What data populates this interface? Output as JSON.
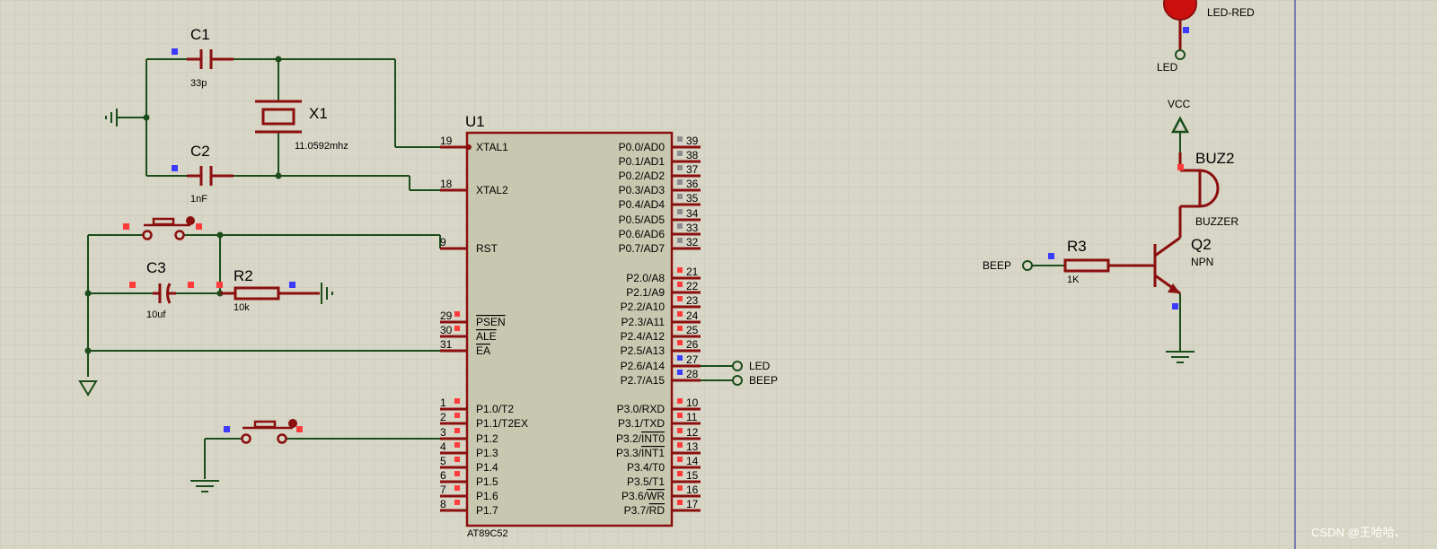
{
  "chip": {
    "ref": "U1",
    "part": "AT89C52",
    "left_pins": [
      {
        "num": "19",
        "name": "XTAL1"
      },
      {
        "num": "18",
        "name": "XTAL2"
      },
      {
        "num": "9",
        "name": "RST"
      },
      {
        "num": "29",
        "name": "PSEN",
        "overline": true
      },
      {
        "num": "30",
        "name": "ALE",
        "overline": true
      },
      {
        "num": "31",
        "name": "EA",
        "overline": true
      },
      {
        "num": "1",
        "name": "P1.0/T2"
      },
      {
        "num": "2",
        "name": "P1.1/T2EX"
      },
      {
        "num": "3",
        "name": "P1.2"
      },
      {
        "num": "4",
        "name": "P1.3"
      },
      {
        "num": "5",
        "name": "P1.4"
      },
      {
        "num": "6",
        "name": "P1.5"
      },
      {
        "num": "7",
        "name": "P1.6"
      },
      {
        "num": "8",
        "name": "P1.7"
      }
    ],
    "right_pins": [
      {
        "num": "39",
        "name": "P0.0/AD0"
      },
      {
        "num": "38",
        "name": "P0.1/AD1"
      },
      {
        "num": "37",
        "name": "P0.2/AD2"
      },
      {
        "num": "36",
        "name": "P0.3/AD3"
      },
      {
        "num": "35",
        "name": "P0.4/AD4"
      },
      {
        "num": "34",
        "name": "P0.5/AD5"
      },
      {
        "num": "33",
        "name": "P0.6/AD6"
      },
      {
        "num": "32",
        "name": "P0.7/AD7"
      },
      {
        "num": "21",
        "name": "P2.0/A8"
      },
      {
        "num": "22",
        "name": "P2.1/A9"
      },
      {
        "num": "23",
        "name": "P2.2/A10"
      },
      {
        "num": "24",
        "name": "P2.3/A11"
      },
      {
        "num": "25",
        "name": "P2.4/A12"
      },
      {
        "num": "26",
        "name": "P2.5/A13"
      },
      {
        "num": "27",
        "name": "P2.6/A14"
      },
      {
        "num": "28",
        "name": "P2.7/A15"
      },
      {
        "num": "10",
        "name": "P3.0/RXD"
      },
      {
        "num": "11",
        "name": "P3.1/TXD"
      },
      {
        "num": "12",
        "name": "P3.2/",
        "bar": "INT0"
      },
      {
        "num": "13",
        "name": "P3.3/",
        "bar": "INT1"
      },
      {
        "num": "14",
        "name": "P3.4/T0"
      },
      {
        "num": "15",
        "name": "P3.5/T1"
      },
      {
        "num": "16",
        "name": "P3.6/",
        "bar": "WR"
      },
      {
        "num": "17",
        "name": "P3.7/",
        "bar": "RD"
      }
    ]
  },
  "parts": {
    "c1": {
      "ref": "C1",
      "value": "33p"
    },
    "c2": {
      "ref": "C2",
      "value": "1nF"
    },
    "x1": {
      "ref": "X1",
      "value": "11.0592mhz"
    },
    "c3": {
      "ref": "C3",
      "value": "10uf"
    },
    "r2": {
      "ref": "R2",
      "value": "10k"
    },
    "r3": {
      "ref": "R3",
      "value": "1K"
    },
    "q2": {
      "ref": "Q2",
      "value": "NPN"
    },
    "buz2": {
      "ref": "BUZ2",
      "value": "BUZZER"
    },
    "led": {
      "value": "LED-RED"
    }
  },
  "terminals": {
    "led_out": "LED",
    "beep_out": "BEEP",
    "beep_in": "BEEP",
    "led_in": "LED",
    "vcc": "VCC"
  },
  "watermark": "CSDN @王哈哈、",
  "colors": {
    "background": "#d8d6c6",
    "grid": "#c7c5b4",
    "wire": "#1b4d1b",
    "component": "#8b0f0f",
    "chip_fill": "#c8c8b0",
    "red_marker": "#ff3b3b",
    "blue_marker": "#3b3bff",
    "grey_marker": "#8c8c8c",
    "sheet_border": "#2020a0",
    "led_red": "#cc1010"
  }
}
